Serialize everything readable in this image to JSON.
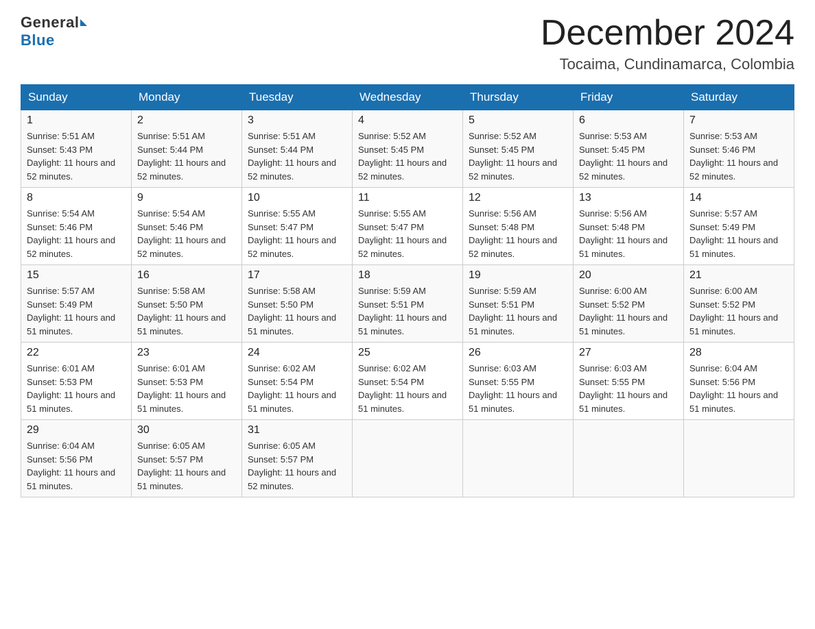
{
  "header": {
    "logo_general": "General",
    "logo_blue": "Blue",
    "month_title": "December 2024",
    "location": "Tocaima, Cundinamarca, Colombia"
  },
  "weekdays": [
    "Sunday",
    "Monday",
    "Tuesday",
    "Wednesday",
    "Thursday",
    "Friday",
    "Saturday"
  ],
  "weeks": [
    [
      {
        "day": "1",
        "sunrise": "5:51 AM",
        "sunset": "5:43 PM",
        "daylight": "11 hours and 52 minutes."
      },
      {
        "day": "2",
        "sunrise": "5:51 AM",
        "sunset": "5:44 PM",
        "daylight": "11 hours and 52 minutes."
      },
      {
        "day": "3",
        "sunrise": "5:51 AM",
        "sunset": "5:44 PM",
        "daylight": "11 hours and 52 minutes."
      },
      {
        "day": "4",
        "sunrise": "5:52 AM",
        "sunset": "5:45 PM",
        "daylight": "11 hours and 52 minutes."
      },
      {
        "day": "5",
        "sunrise": "5:52 AM",
        "sunset": "5:45 PM",
        "daylight": "11 hours and 52 minutes."
      },
      {
        "day": "6",
        "sunrise": "5:53 AM",
        "sunset": "5:45 PM",
        "daylight": "11 hours and 52 minutes."
      },
      {
        "day": "7",
        "sunrise": "5:53 AM",
        "sunset": "5:46 PM",
        "daylight": "11 hours and 52 minutes."
      }
    ],
    [
      {
        "day": "8",
        "sunrise": "5:54 AM",
        "sunset": "5:46 PM",
        "daylight": "11 hours and 52 minutes."
      },
      {
        "day": "9",
        "sunrise": "5:54 AM",
        "sunset": "5:46 PM",
        "daylight": "11 hours and 52 minutes."
      },
      {
        "day": "10",
        "sunrise": "5:55 AM",
        "sunset": "5:47 PM",
        "daylight": "11 hours and 52 minutes."
      },
      {
        "day": "11",
        "sunrise": "5:55 AM",
        "sunset": "5:47 PM",
        "daylight": "11 hours and 52 minutes."
      },
      {
        "day": "12",
        "sunrise": "5:56 AM",
        "sunset": "5:48 PM",
        "daylight": "11 hours and 52 minutes."
      },
      {
        "day": "13",
        "sunrise": "5:56 AM",
        "sunset": "5:48 PM",
        "daylight": "11 hours and 51 minutes."
      },
      {
        "day": "14",
        "sunrise": "5:57 AM",
        "sunset": "5:49 PM",
        "daylight": "11 hours and 51 minutes."
      }
    ],
    [
      {
        "day": "15",
        "sunrise": "5:57 AM",
        "sunset": "5:49 PM",
        "daylight": "11 hours and 51 minutes."
      },
      {
        "day": "16",
        "sunrise": "5:58 AM",
        "sunset": "5:50 PM",
        "daylight": "11 hours and 51 minutes."
      },
      {
        "day": "17",
        "sunrise": "5:58 AM",
        "sunset": "5:50 PM",
        "daylight": "11 hours and 51 minutes."
      },
      {
        "day": "18",
        "sunrise": "5:59 AM",
        "sunset": "5:51 PM",
        "daylight": "11 hours and 51 minutes."
      },
      {
        "day": "19",
        "sunrise": "5:59 AM",
        "sunset": "5:51 PM",
        "daylight": "11 hours and 51 minutes."
      },
      {
        "day": "20",
        "sunrise": "6:00 AM",
        "sunset": "5:52 PM",
        "daylight": "11 hours and 51 minutes."
      },
      {
        "day": "21",
        "sunrise": "6:00 AM",
        "sunset": "5:52 PM",
        "daylight": "11 hours and 51 minutes."
      }
    ],
    [
      {
        "day": "22",
        "sunrise": "6:01 AM",
        "sunset": "5:53 PM",
        "daylight": "11 hours and 51 minutes."
      },
      {
        "day": "23",
        "sunrise": "6:01 AM",
        "sunset": "5:53 PM",
        "daylight": "11 hours and 51 minutes."
      },
      {
        "day": "24",
        "sunrise": "6:02 AM",
        "sunset": "5:54 PM",
        "daylight": "11 hours and 51 minutes."
      },
      {
        "day": "25",
        "sunrise": "6:02 AM",
        "sunset": "5:54 PM",
        "daylight": "11 hours and 51 minutes."
      },
      {
        "day": "26",
        "sunrise": "6:03 AM",
        "sunset": "5:55 PM",
        "daylight": "11 hours and 51 minutes."
      },
      {
        "day": "27",
        "sunrise": "6:03 AM",
        "sunset": "5:55 PM",
        "daylight": "11 hours and 51 minutes."
      },
      {
        "day": "28",
        "sunrise": "6:04 AM",
        "sunset": "5:56 PM",
        "daylight": "11 hours and 51 minutes."
      }
    ],
    [
      {
        "day": "29",
        "sunrise": "6:04 AM",
        "sunset": "5:56 PM",
        "daylight": "11 hours and 51 minutes."
      },
      {
        "day": "30",
        "sunrise": "6:05 AM",
        "sunset": "5:57 PM",
        "daylight": "11 hours and 51 minutes."
      },
      {
        "day": "31",
        "sunrise": "6:05 AM",
        "sunset": "5:57 PM",
        "daylight": "11 hours and 52 minutes."
      },
      null,
      null,
      null,
      null
    ]
  ]
}
